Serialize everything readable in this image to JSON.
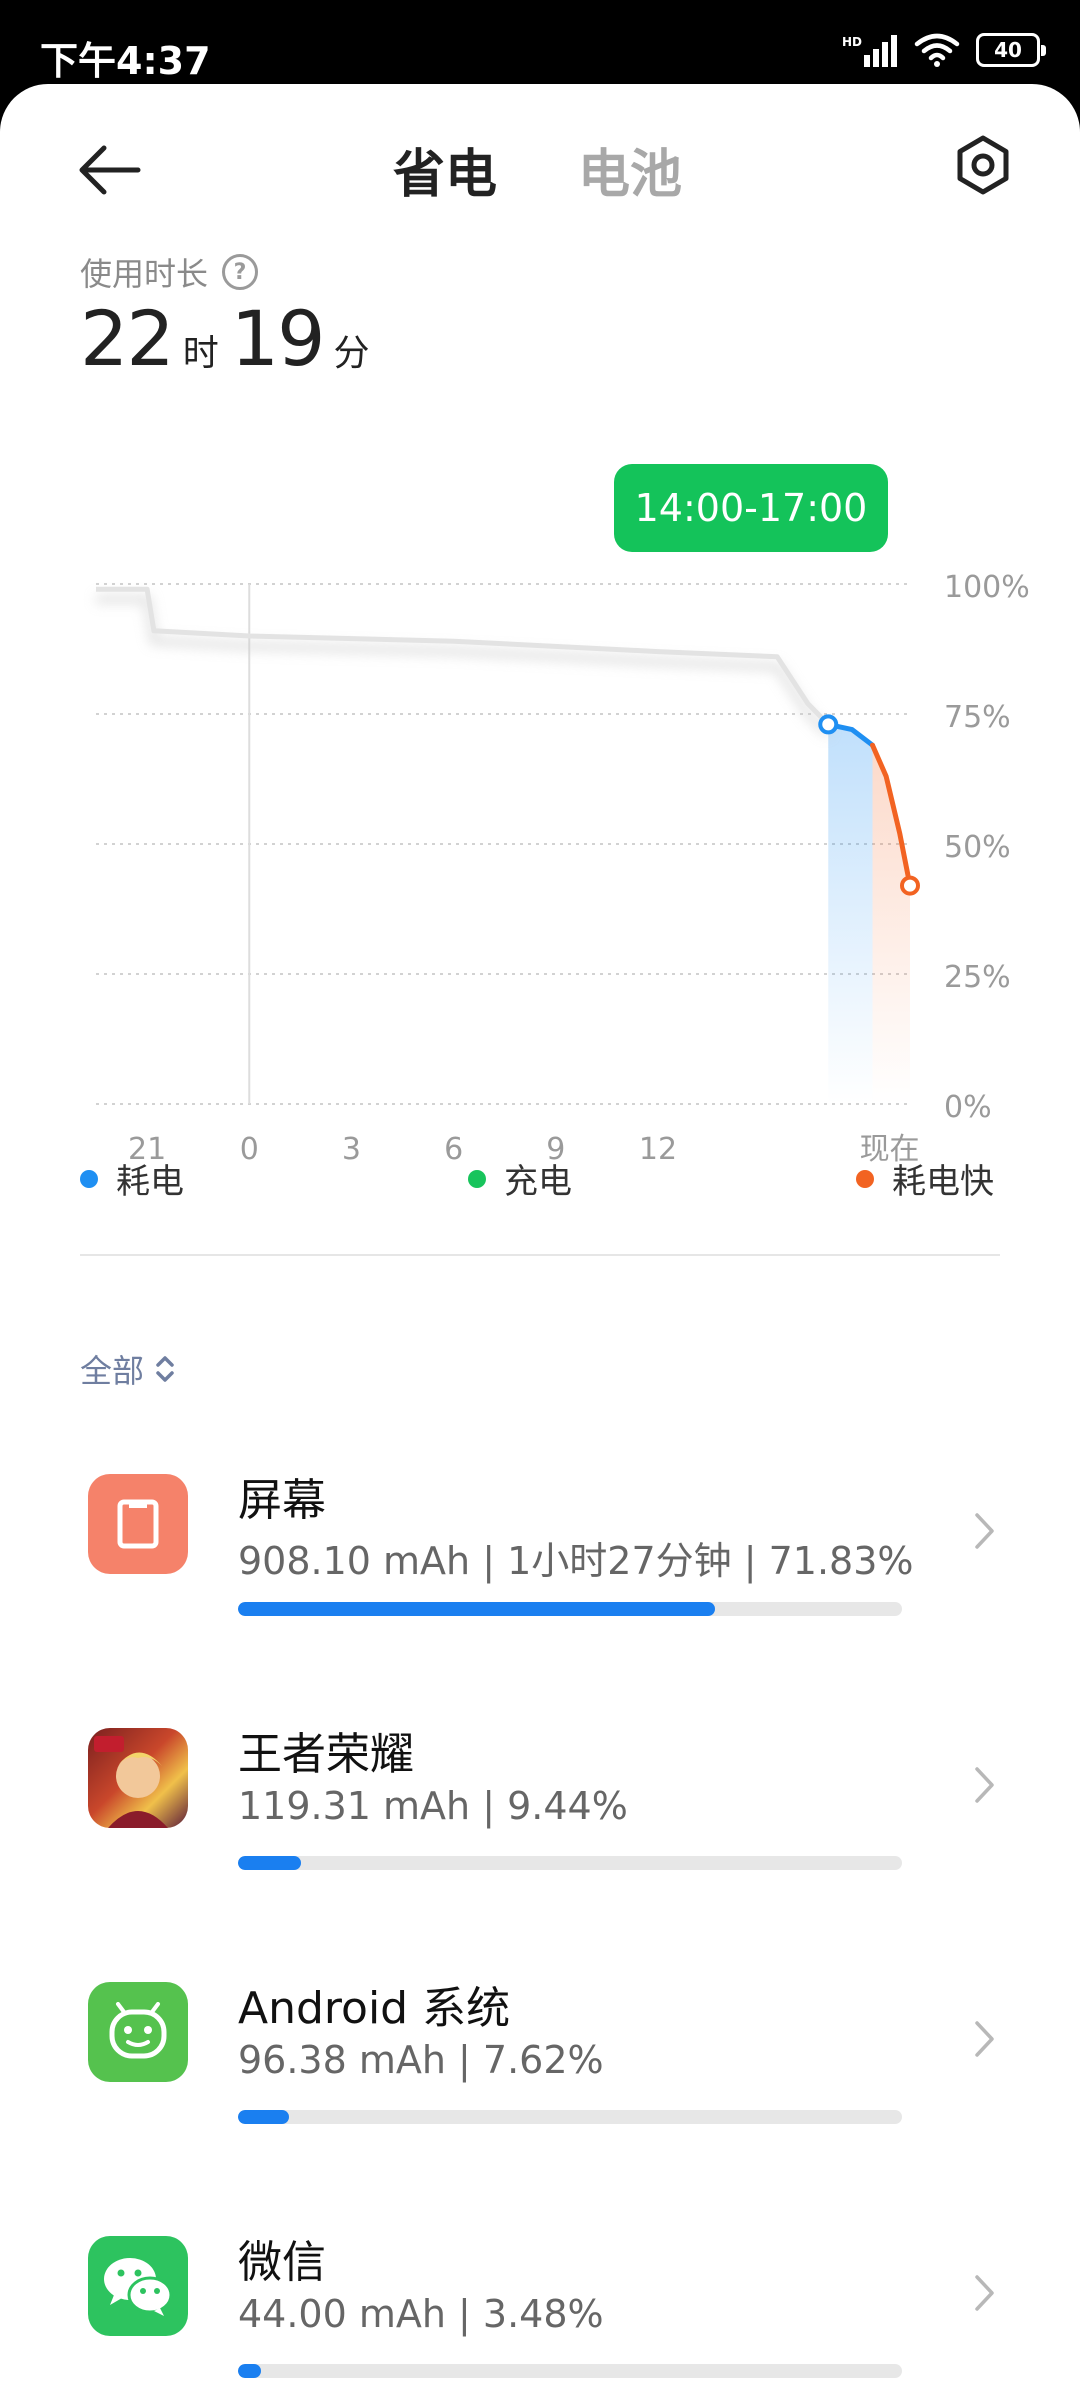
{
  "status_bar": {
    "time": "下午4:37",
    "hd": "HD",
    "battery_level": "40"
  },
  "header": {
    "tab_active": "省电",
    "tab_inactive": "电池"
  },
  "usage": {
    "label": "使用时长",
    "hours": "22",
    "hours_unit": "时",
    "minutes": "19",
    "minutes_unit": "分"
  },
  "chart_data": {
    "type": "line",
    "x_ticks": [
      "21",
      "0",
      "3",
      "6",
      "9",
      "12",
      "现在"
    ],
    "y_ticks": [
      "100%",
      "75%",
      "50%",
      "25%",
      "0%"
    ],
    "ylim": [
      0,
      100
    ],
    "highlight_label": "14:00-17:00",
    "history": [
      {
        "t": 19.5,
        "v": 99
      },
      {
        "t": 21,
        "v": 99
      },
      {
        "t": 21.2,
        "v": 91
      },
      {
        "t": 24,
        "v": 90
      },
      {
        "t": 30,
        "v": 89
      },
      {
        "t": 36,
        "v": 87
      },
      {
        "t": 39.5,
        "v": 86
      },
      {
        "t": 40,
        "v": 81
      },
      {
        "t": 40.4,
        "v": 77
      },
      {
        "t": 41,
        "v": 73
      }
    ],
    "series": [
      {
        "name": "耗电",
        "color": "#1f8ff2",
        "points": [
          {
            "t": 41,
            "v": 73
          },
          {
            "t": 41.7,
            "v": 72
          },
          {
            "t": 42.3,
            "v": 69
          }
        ]
      },
      {
        "name": "耗电快",
        "color": "#f26322",
        "points": [
          {
            "t": 42.3,
            "v": 69
          },
          {
            "t": 42.7,
            "v": 63
          },
          {
            "t": 43.1,
            "v": 52
          },
          {
            "t": 43.4,
            "v": 42
          }
        ]
      }
    ]
  },
  "legend": [
    {
      "label": "耗电",
      "color": "#1f8ff2"
    },
    {
      "label": "充电",
      "color": "#18c45c"
    },
    {
      "label": "耗电快",
      "color": "#f26322"
    }
  ],
  "filter": {
    "label": "全部"
  },
  "apps": [
    {
      "name": "屏幕",
      "stats": "908.10 mAh | 1小时27分钟 | 71.83%",
      "percent": 71.83,
      "icon": "screen-icon"
    },
    {
      "name": "王者荣耀",
      "stats": "119.31 mAh | 9.44%",
      "percent": 9.44,
      "icon": "game-icon"
    },
    {
      "name": "Android 系统",
      "stats": "96.38 mAh | 7.62%",
      "percent": 7.62,
      "icon": "android-icon"
    },
    {
      "name": "微信",
      "stats": "44.00 mAh | 3.48%",
      "percent": 3.48,
      "icon": "wechat-icon"
    }
  ]
}
